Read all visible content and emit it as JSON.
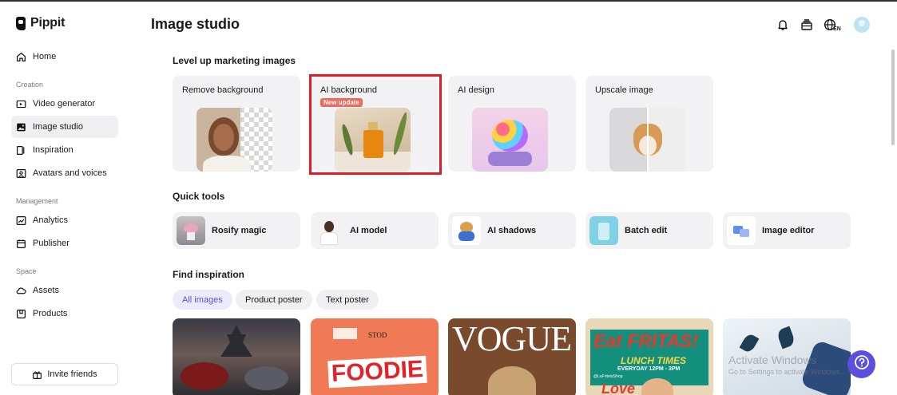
{
  "app": {
    "name": "Pippit"
  },
  "sidebar": {
    "items": [
      {
        "label": "Home",
        "icon": "home-icon"
      },
      {
        "label": "Video generator",
        "icon": "video-generator-icon"
      },
      {
        "label": "Image studio",
        "icon": "image-studio-icon"
      },
      {
        "label": "Inspiration",
        "icon": "inspiration-icon"
      },
      {
        "label": "Avatars and voices",
        "icon": "avatar-icon"
      },
      {
        "label": "Analytics",
        "icon": "analytics-icon"
      },
      {
        "label": "Publisher",
        "icon": "calendar-icon"
      },
      {
        "label": "Assets",
        "icon": "cloud-icon"
      },
      {
        "label": "Products",
        "icon": "box-icon"
      }
    ],
    "sections": {
      "creation": "Creation",
      "management": "Management",
      "space": "Space"
    },
    "invite_label": "Invite friends"
  },
  "header": {
    "title": "Image studio",
    "lang": "EN"
  },
  "level_up": {
    "heading": "Level up marketing images",
    "cards": [
      {
        "title": "Remove background"
      },
      {
        "title": "AI background",
        "badge": "New update"
      },
      {
        "title": "AI design"
      },
      {
        "title": "Upscale image"
      }
    ]
  },
  "quick_tools": {
    "heading": "Quick tools",
    "items": [
      {
        "label": "Rosify magic"
      },
      {
        "label": "AI model"
      },
      {
        "label": "AI shadows"
      },
      {
        "label": "Batch edit"
      },
      {
        "label": "Image editor"
      }
    ]
  },
  "find_inspiration": {
    "heading": "Find inspiration",
    "chips": [
      "All images",
      "Product poster",
      "Text poster"
    ],
    "cards": [
      {
        "text": ""
      },
      {
        "text": "FOODIE",
        "sub": "STOD"
      },
      {
        "text": "VOGUE"
      },
      {
        "text": "Eat FRITAS!",
        "sub": "LUNCH TIMES",
        "sub2": "EVERYDAY 12PM - 3PM",
        "sub3": "@LaFritetaShop",
        "sub4": "Love"
      },
      {
        "text": ""
      }
    ]
  },
  "watermark": {
    "line1": "Activate Windows",
    "line2": "Go to Settings to activate Windows."
  },
  "colors": {
    "accent": "#5b4fe0",
    "highlight": "#e11d24",
    "badge": "#ee6a5f"
  }
}
